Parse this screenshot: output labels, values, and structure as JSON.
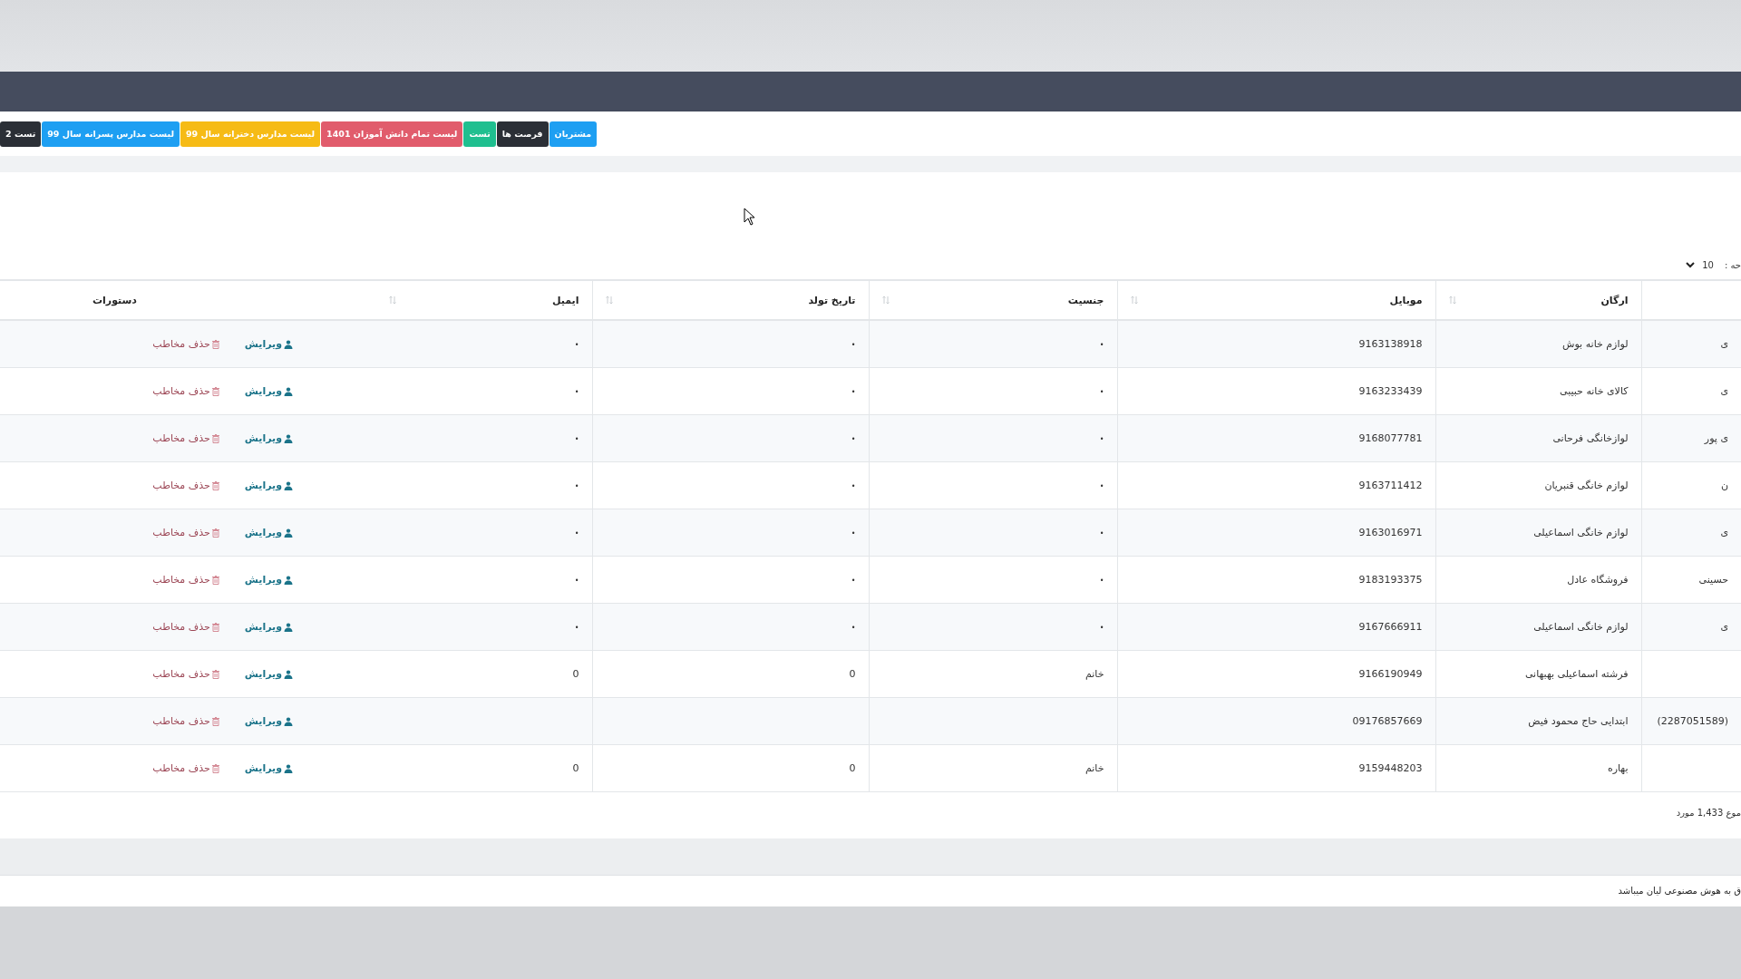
{
  "nav_buttons": [
    {
      "label": "مشتریان",
      "color": "#1e9ff2"
    },
    {
      "label": "فرصت ها",
      "color": "#2b2f36"
    },
    {
      "label": "تست",
      "color": "#1fbf8f"
    },
    {
      "label": "لیست تمام دانش آموزان 1401",
      "color": "#e15c6c"
    },
    {
      "label": "لیست مدارس دخترانه سال 99",
      "color": "#f6bb15"
    },
    {
      "label": "لیست مدارس پسرانه سال 99",
      "color": "#1e9ff2"
    },
    {
      "label": "تست 2",
      "color": "#2b2f36"
    }
  ],
  "page_size": {
    "label": "حه :",
    "value": "10"
  },
  "table": {
    "columns": [
      {
        "label": "ارگان",
        "sortable": true
      },
      {
        "label": "موبایل",
        "sortable": true
      },
      {
        "label": "جنسیت",
        "sortable": true
      },
      {
        "label": "تاریخ تولد",
        "sortable": true
      },
      {
        "label": "ایمیل",
        "sortable": true
      },
      {
        "label": "دستورات",
        "sortable": false
      }
    ],
    "rows": [
      {
        "column_1": "ی",
        "organization": "لوازم خانه بوش",
        "mobile": "9163138918",
        "gender": "•",
        "birth_date": "•",
        "email": "•",
        "actions": [
          {
            "kind": "edit",
            "label": "ویرایش"
          },
          {
            "kind": "delete",
            "label": "حذف مخاطب"
          }
        ]
      },
      {
        "column_1": "ی",
        "organization": "کالای خانه حبیبی",
        "mobile": "9163233439",
        "gender": "•",
        "birth_date": "•",
        "email": "•",
        "actions": [
          {
            "kind": "edit",
            "label": "ویرایش"
          },
          {
            "kind": "delete",
            "label": "حذف مخاطب"
          }
        ]
      },
      {
        "column_1": "ی پور",
        "organization": "لوازخانگی فرحانی",
        "mobile": "9168077781",
        "gender": "•",
        "birth_date": "•",
        "email": "•",
        "actions": [
          {
            "kind": "edit",
            "label": "ویرایش"
          },
          {
            "kind": "delete",
            "label": "حذف مخاطب"
          }
        ]
      },
      {
        "column_1": "ن",
        "organization": "لوازم خانگی قنبریان",
        "mobile": "9163711412",
        "gender": "•",
        "birth_date": "•",
        "email": "•",
        "actions": [
          {
            "kind": "edit",
            "label": "ویرایش"
          },
          {
            "kind": "delete",
            "label": "حذف مخاطب"
          }
        ]
      },
      {
        "column_1": "ی",
        "organization": "لوازم خانگی اسماعیلی",
        "mobile": "9163016971",
        "gender": "•",
        "birth_date": "•",
        "email": "•",
        "actions": [
          {
            "kind": "edit",
            "label": "ویرایش"
          },
          {
            "kind": "delete",
            "label": "حذف مخاطب"
          }
        ]
      },
      {
        "column_1": "حسینی",
        "organization": "فروشگاه عادل",
        "mobile": "9183193375",
        "gender": "•",
        "birth_date": "•",
        "email": "•",
        "actions": [
          {
            "kind": "edit",
            "label": "ویرایش"
          },
          {
            "kind": "delete",
            "label": "حذف مخاطب"
          }
        ]
      },
      {
        "column_1": "ی",
        "organization": "لوازم خانگی اسماعیلی",
        "mobile": "9167666911",
        "gender": "•",
        "birth_date": "•",
        "email": "•",
        "actions": [
          {
            "kind": "edit",
            "label": "ویرایش"
          },
          {
            "kind": "delete",
            "label": "حذف مخاطب"
          }
        ]
      },
      {
        "organization": "فرشته اسماعیلی بهبهانی",
        "mobile": "9166190949",
        "gender": "خانم",
        "birth_date": "0",
        "email": "0",
        "actions": [
          {
            "kind": "edit",
            "label": "ویرایش"
          },
          {
            "kind": "delete",
            "label": "حذف مخاطب"
          }
        ]
      },
      {
        "column_1": "(2287051589)",
        "organization": "ابتدایی حاج محمود فیض",
        "mobile": "09176857669",
        "actions": [
          {
            "kind": "edit",
            "label": "ویرایش"
          },
          {
            "kind": "delete",
            "label": "حذف مخاطب"
          }
        ]
      },
      {
        "organization": "بهاره",
        "mobile": "9159448203",
        "gender": "خانم",
        "birth_date": "0",
        "email": "0",
        "actions": [
          {
            "kind": "edit",
            "label": "ویرایش"
          },
          {
            "kind": "delete",
            "label": "حذف مخاطب"
          }
        ]
      }
    ]
  },
  "total": "موع 1,433 مورد",
  "footer_text": "ق به هوش مصنوعی لیان میباشد"
}
